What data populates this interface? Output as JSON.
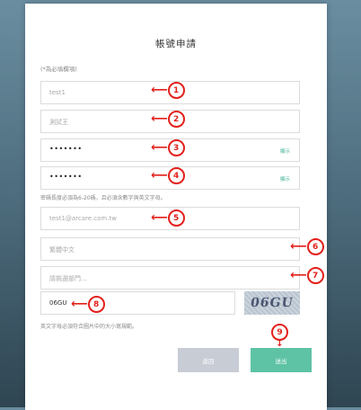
{
  "form": {
    "title": "帳號申請",
    "required_note": "(*為必填欄項)",
    "fields": {
      "account": {
        "placeholder": "test1"
      },
      "name": {
        "placeholder": "測試王"
      },
      "password": {
        "value": "•••••••",
        "show_label": "顯示"
      },
      "password_confirm": {
        "value": "•••••••",
        "show_label": "顯示"
      },
      "password_hint": "密碼長度必須為6-20碼，且必須含數字與英文字母。",
      "email": {
        "placeholder": "test1@arcare.com.tw"
      },
      "language": {
        "placeholder": "繁體中文"
      },
      "department": {
        "placeholder": "請挑選部門..."
      },
      "captcha": {
        "value": "06GU",
        "image_text": "06GU"
      },
      "captcha_hint": "英文字母必須符合圖片中的大小寫規範。"
    },
    "buttons": {
      "back": "返回",
      "submit": "送出"
    }
  },
  "annotations": [
    "1",
    "2",
    "3",
    "4",
    "5",
    "6",
    "7",
    "8",
    "9"
  ],
  "colors": {
    "accent": "#5ec3a4",
    "annotation": "#e3201b",
    "back_button": "#c8ccd5"
  }
}
